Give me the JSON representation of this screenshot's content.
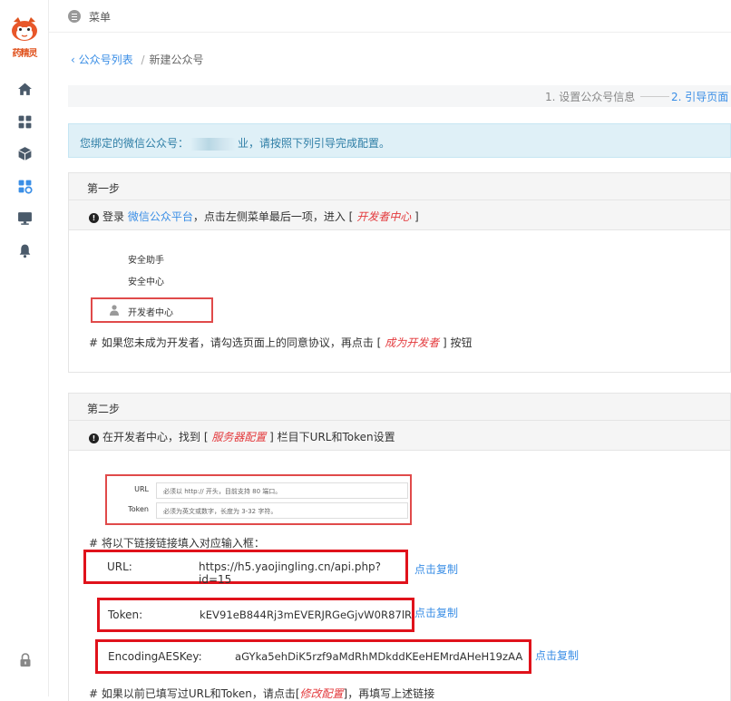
{
  "sidebar": {
    "logo_text": "药精灵",
    "items": [
      {
        "icon": "home-icon"
      },
      {
        "icon": "grid-icon"
      },
      {
        "icon": "cube-icon"
      },
      {
        "icon": "apps-settings-icon"
      },
      {
        "icon": "monitor-icon"
      },
      {
        "icon": "bell-icon"
      }
    ],
    "bottom_icon": "lock-icon"
  },
  "header": {
    "menu_label": "菜单"
  },
  "breadcrumb": {
    "parent": "公众号列表",
    "separator": "/",
    "current": "新建公众号"
  },
  "steps": {
    "step1": "1. 设置公众号信息",
    "step2": "2. 引导页面"
  },
  "alert": {
    "prefix": "您绑定的微信公众号：",
    "redacted_tail": "业",
    "suffix": "，请按照下列引导完成配置。"
  },
  "step_one": {
    "title": "第一步",
    "instruction_pre": "登录",
    "platform_link": "微信公众平台",
    "instruction_mid": "，点击左侧菜单最后一项，进入 [",
    "dev_center": "开发者中心",
    "instruction_post": "]",
    "menu_items": [
      "安全助手",
      "安全中心",
      "开发者中心"
    ],
    "note_pre": "# 如果您未成为开发者，请勾选页面上的同意协议，再点击 [",
    "note_em": "成为开发者",
    "note_post": "] 按钮"
  },
  "step_two": {
    "title": "第二步",
    "instruction_pre": "在开发者中心，找到 [",
    "server_config": "服务器配置",
    "instruction_post": "] 栏目下URL和Token设置",
    "form": {
      "url_label": "URL",
      "url_hint": "必须以 http:// 开头，目前支持 80 端口。",
      "token_label": "Token",
      "token_hint": "必须为英文或数字，长度为 3-32 字符。"
    },
    "fill_note": "# 将以下链接链接填入对应输入框：",
    "url": {
      "label": "URL:",
      "value": "https://h5.yaojingling.cn/api.php?id=15",
      "copy": "点击复制"
    },
    "token": {
      "label": "Token:",
      "value": "kEV91eB844Rj3mEVERJRGeGjvW0R87lR",
      "copy": "点击复制"
    },
    "aes": {
      "label": "EncodingAESKey:",
      "value": "aGYka5ehDiK5rzf9aMdRhMDkddKEeHEMrdAHeH19zAA",
      "copy": "点击复制"
    },
    "bottom_note_pre": "# 如果以前已填写过URL和Token，请点击[",
    "bottom_note_em": "修改配置",
    "bottom_note_post": "]，再填写上述链接"
  }
}
